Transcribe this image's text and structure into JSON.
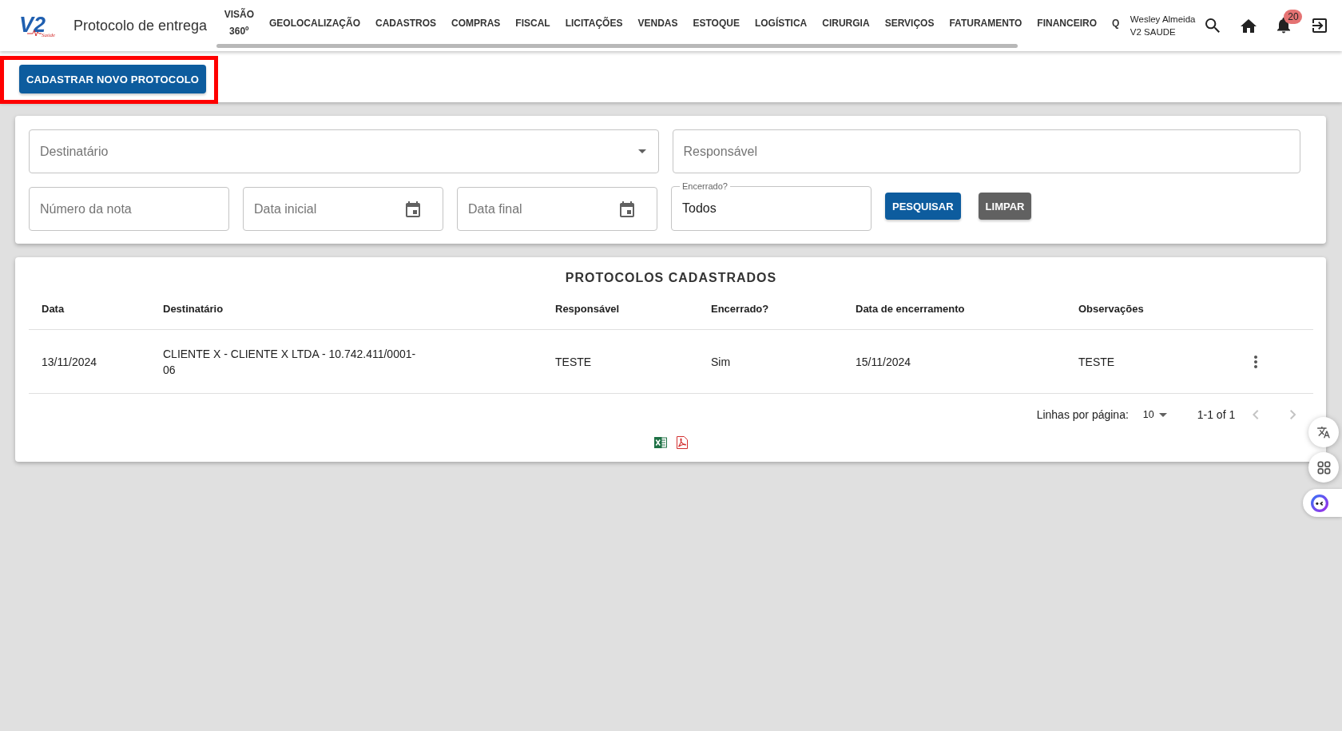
{
  "header": {
    "logo": {
      "mark": "V2",
      "tagline": "Saúde"
    },
    "title": "Protocolo de entrega",
    "nav": [
      {
        "label": "VISÃO 360º"
      },
      {
        "label": "GEOLOCALIZAÇÃO"
      },
      {
        "label": "CADASTROS"
      },
      {
        "label": "COMPRAS"
      },
      {
        "label": "FISCAL"
      },
      {
        "label": "LICITAÇÕES"
      },
      {
        "label": "VENDAS"
      },
      {
        "label": "ESTOQUE"
      },
      {
        "label": "LOGÍSTICA"
      },
      {
        "label": "CIRURGIA"
      },
      {
        "label": "SERVIÇOS"
      },
      {
        "label": "FATURAMENTO"
      },
      {
        "label": "FINANCEIRO"
      },
      {
        "label": "Q"
      }
    ],
    "user": {
      "name": "Wesley Almeida",
      "org": "V2 SAUDE"
    },
    "notifications": {
      "count": "20"
    }
  },
  "toolbar": {
    "new_button": {
      "label": "CADASTRAR NOVO PROTOCOLO",
      "highlighted": true
    }
  },
  "filters": {
    "rows": [
      {
        "fields": [
          {
            "kind": "select",
            "placeholder": "Destinatário"
          },
          {
            "kind": "text",
            "placeholder": "Responsável"
          }
        ]
      },
      {
        "fields": [
          {
            "kind": "text",
            "placeholder": "Número da nota"
          },
          {
            "kind": "date",
            "placeholder": "Data inicial"
          },
          {
            "kind": "date",
            "placeholder": "Data final"
          },
          {
            "kind": "select",
            "label": "Encerrado?",
            "value": "Todos"
          }
        ],
        "buttons": [
          {
            "kind": "primary",
            "label": "PESQUISAR"
          },
          {
            "kind": "secondary",
            "label": "LIMPAR"
          }
        ]
      }
    ]
  },
  "table": {
    "title": "PROTOCOLOS CADASTRADOS",
    "columns": [
      "Data",
      "Destinatário",
      "Responsável",
      "Encerrado?",
      "Data de encerramento",
      "Observações"
    ],
    "rows": [
      {
        "cells": [
          "13/11/2024",
          "CLIENTE X - CLIENTE X LTDA - 10.742.411/0001-06",
          "TESTE",
          "Sim",
          "15/11/2024",
          "TESTE"
        ]
      }
    ],
    "pagination": {
      "rows_label": "Linhas por página:",
      "rows_per_page": "10",
      "range": "1-1 of 1",
      "nav_buttons": [
        {
          "kind": "prev",
          "disabled": true
        },
        {
          "kind": "next",
          "disabled": true
        }
      ]
    }
  }
}
